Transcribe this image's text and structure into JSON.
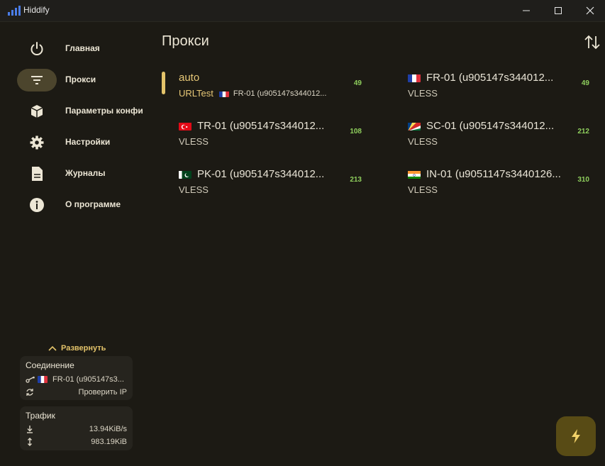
{
  "window": {
    "title": "Hiddify"
  },
  "sidebar": {
    "items": [
      {
        "label": "Главная",
        "icon": "power-icon",
        "active": false
      },
      {
        "label": "Прокси",
        "icon": "filter-icon",
        "active": true
      },
      {
        "label": "Параметры конфи",
        "icon": "box-icon",
        "active": false
      },
      {
        "label": "Настройки",
        "icon": "gear-icon",
        "active": false
      },
      {
        "label": "Журналы",
        "icon": "document-icon",
        "active": false
      },
      {
        "label": "О программе",
        "icon": "info-icon",
        "active": false
      }
    ],
    "expand_label": "Развернуть",
    "connection": {
      "title": "Соединение",
      "server": "FR-01 (u905147s3...",
      "check_ip": "Проверить IP"
    },
    "traffic": {
      "title": "Трафик",
      "download": "13.94KiB/s",
      "upload": "983.19KiB"
    }
  },
  "main": {
    "title": "Прокси",
    "proxies": [
      {
        "name": "auto",
        "type": "URLTest",
        "detail": "FR-01 (u905147s344012...",
        "ping": "49",
        "selected": true
      },
      {
        "name": "FR-01 (u905147s344012...",
        "type": "VLESS",
        "ping": "49",
        "flag": "fr"
      },
      {
        "name": "TR-01 (u905147s344012...",
        "type": "VLESS",
        "ping": "108",
        "flag": "tr"
      },
      {
        "name": "SC-01 (u905147s344012...",
        "type": "VLESS",
        "ping": "212",
        "flag": "sc"
      },
      {
        "name": "PK-01 (u905147s344012...",
        "type": "VLESS",
        "ping": "213",
        "flag": "pk"
      },
      {
        "name": "IN-01 (u9051147s3440126...",
        "type": "VLESS",
        "ping": "310",
        "flag": "in"
      }
    ]
  },
  "colors": {
    "accent": "#e3c36a",
    "ping": "#8fcf5d",
    "background": "#1c1a14",
    "fab": "#584b15"
  }
}
